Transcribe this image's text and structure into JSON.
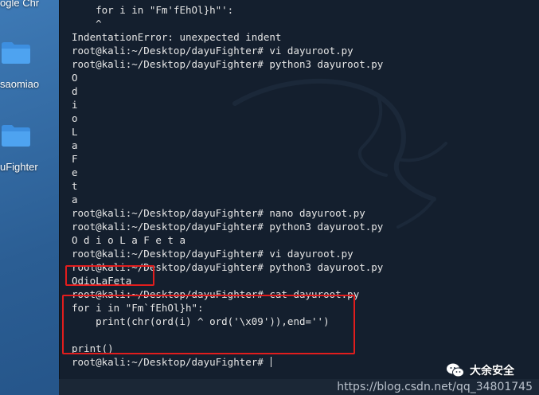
{
  "desktop": {
    "icons": [
      {
        "label": "ogle Chr",
        "icon": "chrome-shortcut-icon"
      },
      {
        "label": "saomiao",
        "icon": "folder-icon"
      },
      {
        "label": "uFighter",
        "icon": "folder-icon"
      }
    ]
  },
  "terminal": {
    "lines": [
      "    for i in \"Fm'fEhOl}h\"':",
      "    ^",
      "IndentationError: unexpected indent",
      "root@kali:~/Desktop/dayuFighter# vi dayuroot.py",
      "root@kali:~/Desktop/dayuFighter# python3 dayuroot.py",
      "O",
      "d",
      "i",
      "o",
      "L",
      "a",
      "F",
      "e",
      "t",
      "a",
      "root@kali:~/Desktop/dayuFighter# nano dayuroot.py",
      "root@kali:~/Desktop/dayuFighter# python3 dayuroot.py",
      "O d i o L a F e t a",
      "root@kali:~/Desktop/dayuFighter# vi dayuroot.py",
      "root@kali:~/Desktop/dayuFighter# python3 dayuroot.py",
      "OdioLaFeta",
      "root@kali:~/Desktop/dayuFighter# cat dayuroot.py",
      "for i in \"Fm`fEhOl}h\":",
      "    print(chr(ord(i) ^ ord('\\x09')),end='')",
      "",
      "print()",
      "root@kali:~/Desktop/dayuFighter# "
    ],
    "colors": {
      "background": "#141f2e",
      "text": "#e6e6e6",
      "highlight": "#e11d1d"
    }
  },
  "footer": {
    "brand": "大余安全",
    "url": "https://blog.csdn.net/qq_34801745"
  }
}
